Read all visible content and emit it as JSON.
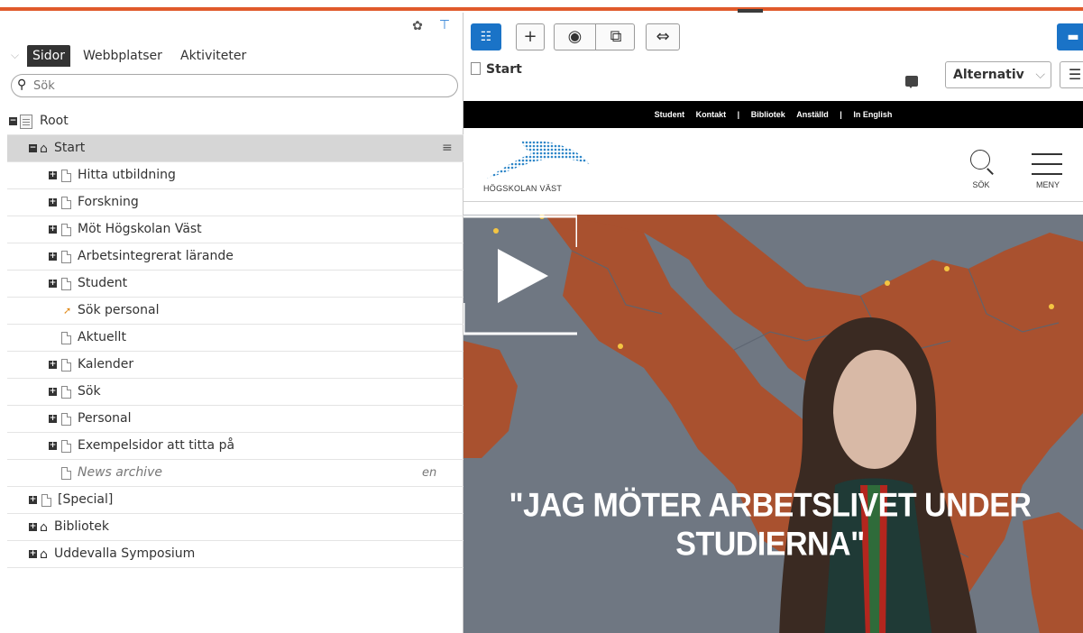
{
  "nav": {
    "tabs": [
      {
        "label": "Sidor"
      },
      {
        "label": "Webbplatser"
      },
      {
        "label": "Aktiviteter"
      }
    ],
    "search": {
      "placeholder": "Sök",
      "value": ""
    },
    "tree": [
      {
        "label": "Root"
      },
      {
        "label": "Start"
      },
      {
        "label": "Hitta utbildning"
      },
      {
        "label": "Forskning"
      },
      {
        "label": "Möt Högskolan Väst"
      },
      {
        "label": "Arbetsintegrerat lärande"
      },
      {
        "label": "Student"
      },
      {
        "label": "Sök personal"
      },
      {
        "label": "Aktuellt"
      },
      {
        "label": "Kalender"
      },
      {
        "label": "Sök"
      },
      {
        "label": "Personal"
      },
      {
        "label": "Exempelsidor att titta på"
      },
      {
        "label": "News archive",
        "lang": "en"
      },
      {
        "label": "[Special]"
      },
      {
        "label": "Bibliotek"
      },
      {
        "label": "Uddevalla Symposium"
      }
    ]
  },
  "preview": {
    "breadcrumb": "Start",
    "options_label": "Alternativ",
    "site_links": [
      "Student",
      "Kontakt",
      "|",
      "Bibliotek",
      "Anställd",
      "|",
      "In English"
    ],
    "logo_text": "HÖGSKOLAN VÄST",
    "search_label": "SÖK",
    "menu_label": "MENY",
    "hero_title_line1": "\"JAG MÖTER ARBETSLIVET UNDER",
    "hero_title_line2": "STUDIERNA\""
  },
  "colors": {
    "accent": "#e05a2b",
    "highlight": "#fff51f",
    "tool_blue": "#1a73c7",
    "map_land": "#a9512f"
  },
  "icons": [
    "gear-icon",
    "pin-icon",
    "search-icon",
    "page-icon",
    "home-icon",
    "list-icon",
    "shortcut-icon",
    "chat-icon",
    "play-icon",
    "menu-icon"
  ]
}
